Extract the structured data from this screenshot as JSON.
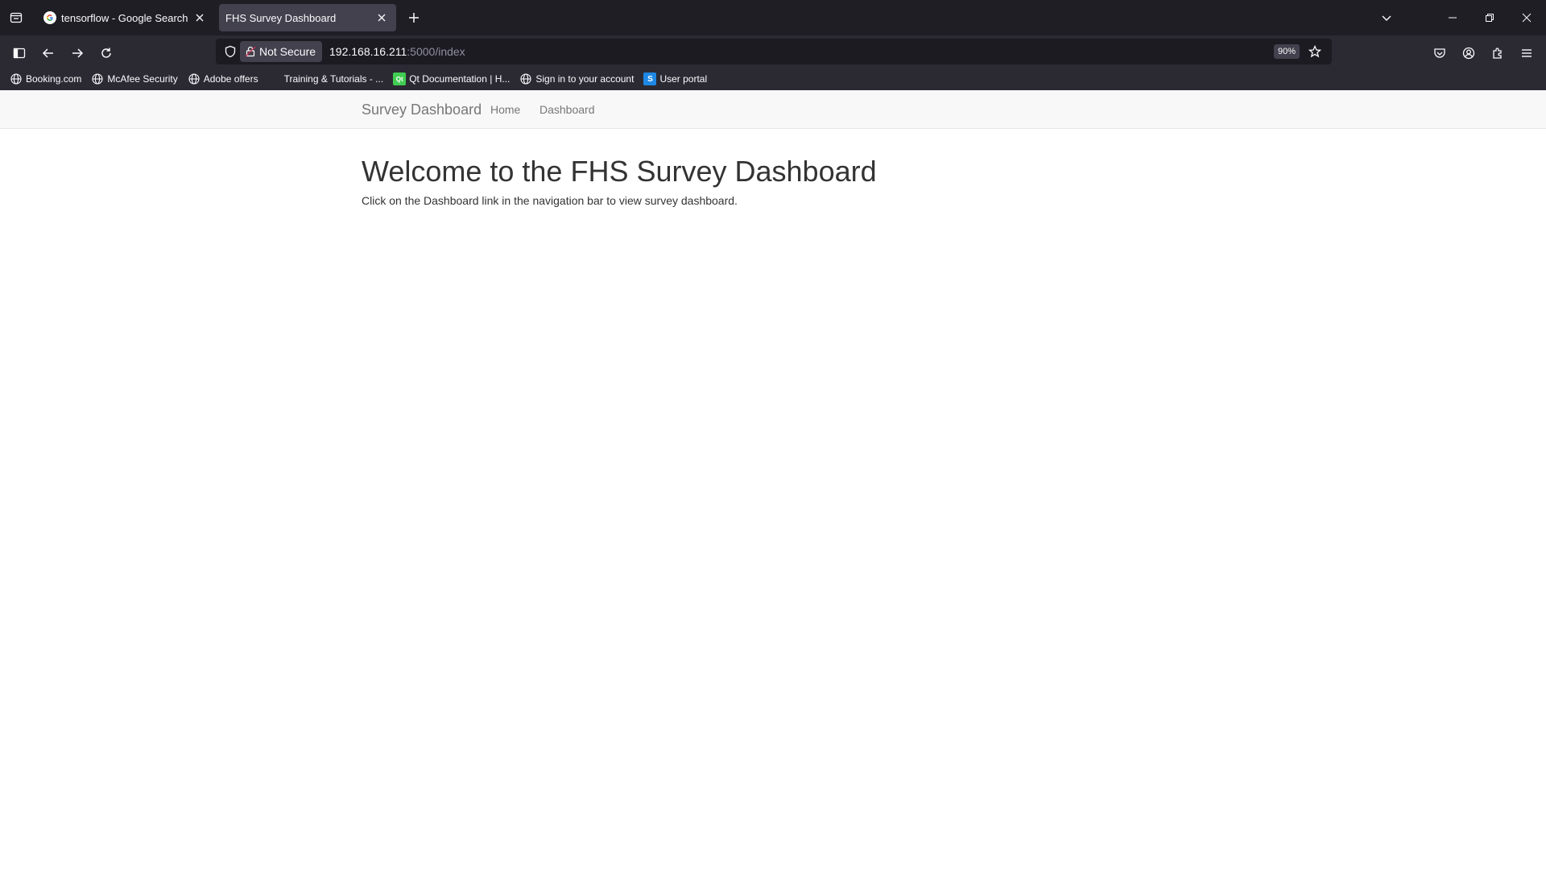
{
  "tabs": [
    {
      "title": "tensorflow - Google Search",
      "favicon": "google-icon",
      "active": false
    },
    {
      "title": "FHS Survey Dashboard",
      "favicon": "",
      "active": true
    }
  ],
  "address_bar": {
    "security_label": "Not Secure",
    "url_host": "192.168.16.211",
    "url_path": ":5000/index",
    "zoom": "90%"
  },
  "bookmarks": [
    {
      "label": "Booking.com",
      "icon": "globe-icon"
    },
    {
      "label": "McAfee Security",
      "icon": "globe-icon"
    },
    {
      "label": "Adobe offers",
      "icon": "globe-icon"
    },
    {
      "label": "Training & Tutorials - ...",
      "icon": "none"
    },
    {
      "label": "Qt Documentation | H...",
      "icon": "qt-icon"
    },
    {
      "label": "Sign in to your account",
      "icon": "globe-icon"
    },
    {
      "label": "User portal",
      "icon": "s-icon"
    }
  ],
  "page": {
    "brand": "Survey Dashboard",
    "nav": [
      "Home",
      "Dashboard"
    ],
    "heading": "Welcome to the FHS Survey Dashboard",
    "text": "Click on the Dashboard link in the navigation bar to view survey dashboard."
  },
  "colors": {
    "tabstrip_bg": "#1f1e25",
    "toolbar_bg": "#2b2a33",
    "active_tab_bg": "#42414d",
    "site_nav_bg": "#f8f8f8",
    "nav_text": "#777777",
    "heading_text": "#333333"
  }
}
